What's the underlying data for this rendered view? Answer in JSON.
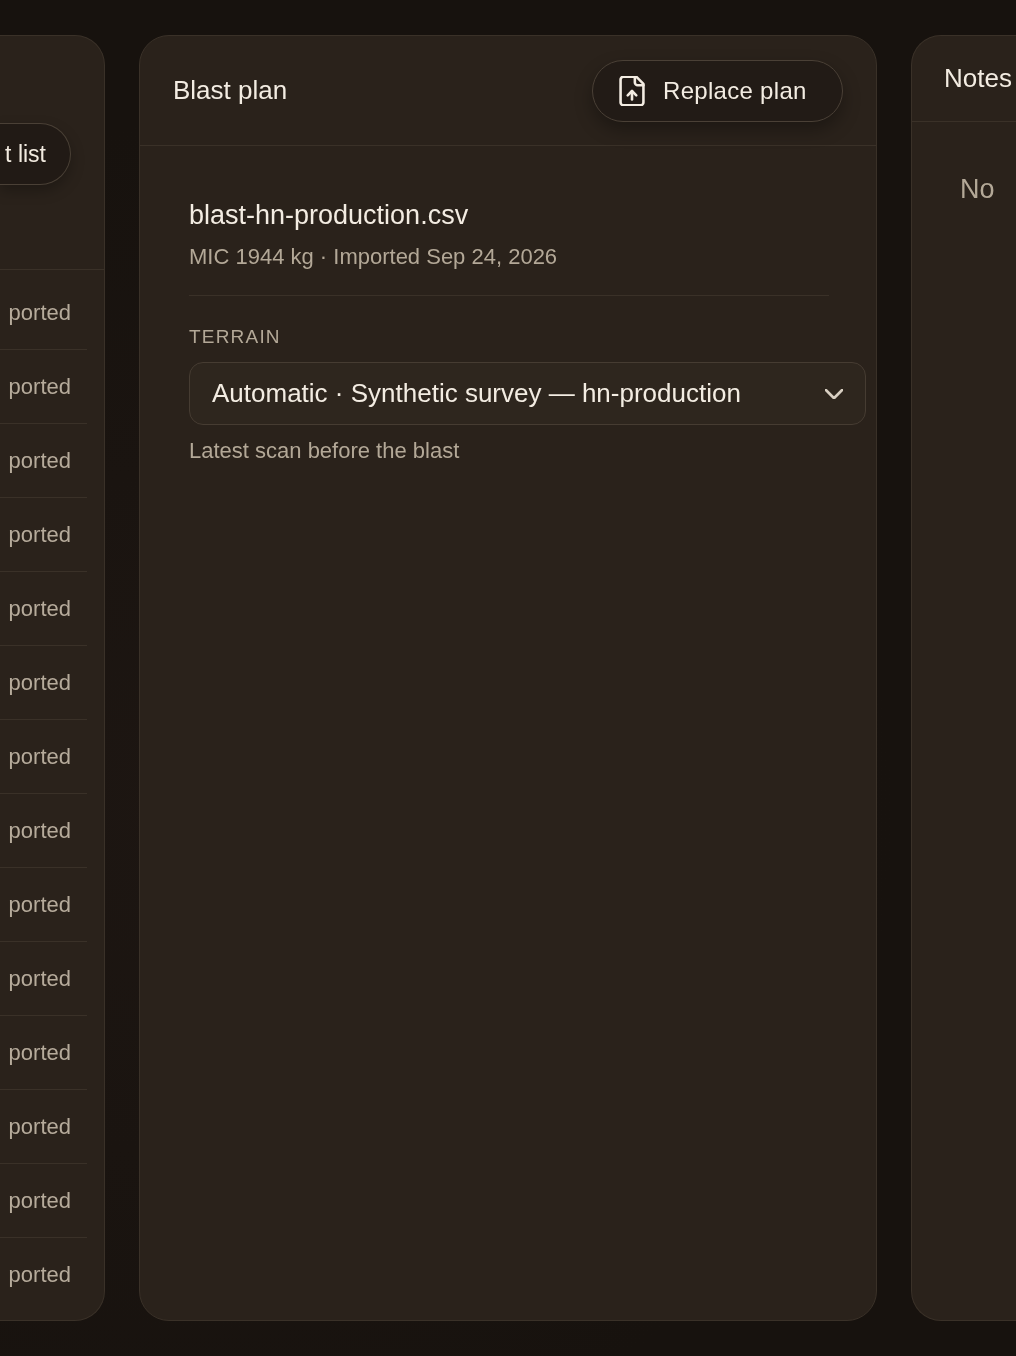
{
  "left_panel": {
    "button": "t list",
    "rows": [
      "ported",
      "ported",
      "ported",
      "ported",
      "ported",
      "ported",
      "ported",
      "ported",
      "ported",
      "ported",
      "ported",
      "ported",
      "ported",
      "ported"
    ]
  },
  "plan_panel": {
    "title": "Blast plan",
    "replace_button": "Replace plan",
    "file": {
      "name": "blast-hn-production.csv",
      "meta": "MIC 1944 kg · Imported Sep 24, 2026"
    },
    "terrain": {
      "label": "TERRAIN",
      "value": "Automatic · Synthetic survey — hn-production",
      "hint": "Latest scan before the blast"
    }
  },
  "notes_panel": {
    "title": "Notes",
    "empty_text": "No"
  }
}
